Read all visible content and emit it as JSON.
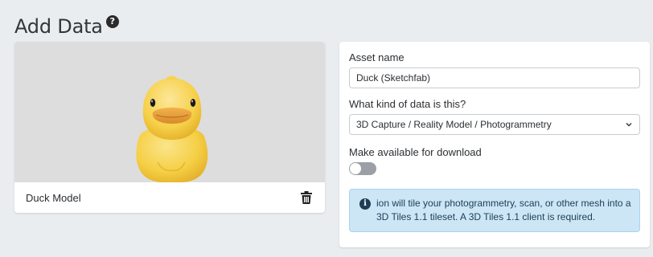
{
  "header": {
    "title": "Add Data",
    "help_icon": "?"
  },
  "preview": {
    "image": "duck-3d-model-icon",
    "model_name": "Duck Model",
    "delete_icon": "trash-icon"
  },
  "form": {
    "asset_name_label": "Asset name",
    "asset_name_value": "Duck (Sketchfab)",
    "data_kind_label": "What kind of data is this?",
    "data_kind_selected": "3D Capture / Reality Model / Photogrammetry",
    "download_label": "Make available for download",
    "download_enabled": false,
    "info_icon": "i",
    "info_text": "ion will tile your photogrammetry, scan, or other mesh into a 3D Tiles 1.1 tileset. A 3D Tiles 1.1 client is required."
  },
  "colors": {
    "background": "#e9edf0",
    "info_bg": "#cce6f5",
    "info_text": "#1d3e55",
    "duck_yellow": "#f7d24e"
  }
}
